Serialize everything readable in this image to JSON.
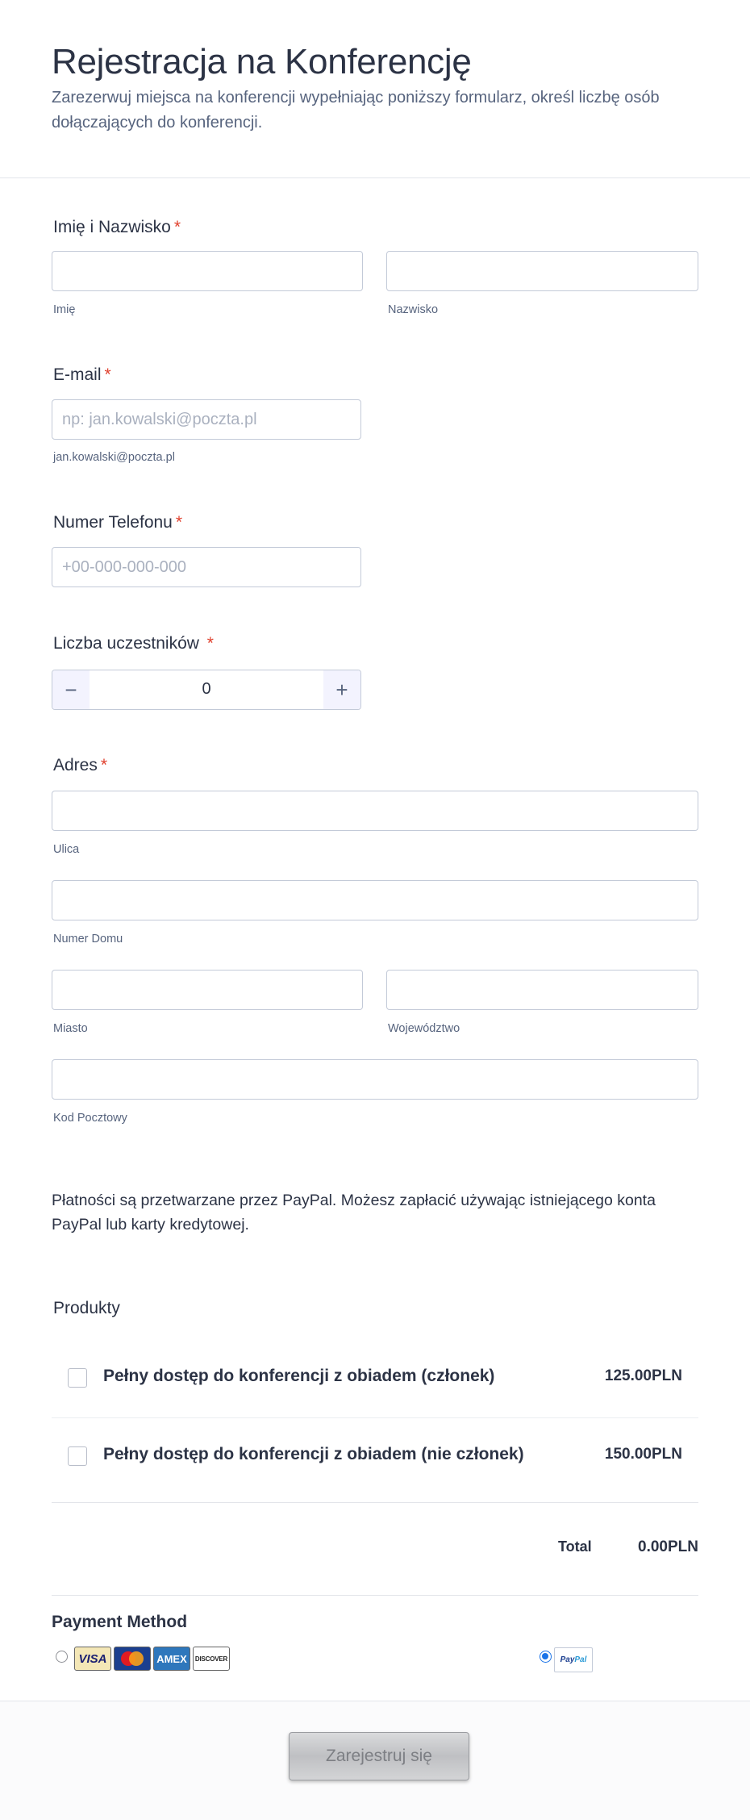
{
  "header": {
    "title": "Rejestracja na Konferencję",
    "subtitle": "Zarezerwuj miejsca na konferencji wypełniając poniższy formularz, określ liczbę osób dołączających do konferencji."
  },
  "name_field": {
    "label": "Imię i Nazwisko",
    "required_mark": "*",
    "first_value": "",
    "last_value": "",
    "first_sublabel": "Imię",
    "last_sublabel": "Nazwisko"
  },
  "email_field": {
    "label": "E-mail",
    "required_mark": "*",
    "value": "",
    "placeholder": "np: jan.kowalski@poczta.pl",
    "sublabel": "jan.kowalski@poczta.pl"
  },
  "phone_field": {
    "label": "Numer Telefonu",
    "required_mark": "*",
    "value": "",
    "placeholder": "+00-000-000-000"
  },
  "participants_field": {
    "label": "Liczba uczestników",
    "required_mark": "*",
    "minus": "−",
    "plus": "+",
    "value": "0"
  },
  "address_field": {
    "label": "Adres",
    "required_mark": "*",
    "street_sublabel": "Ulica",
    "house_sublabel": "Numer Domu",
    "city_sublabel": "Miasto",
    "state_sublabel": "Województwo",
    "postal_sublabel": "Kod Pocztowy"
  },
  "payment_info": "Płatności są przetwarzane przez PayPal. Możesz zapłacić używając istniejącego konta PayPal lub karty kredytowej.",
  "products": {
    "label": "Produkty",
    "items": [
      {
        "name": "Pełny dostęp do konferencji z obiadem (członek)",
        "price": "125.00",
        "currency": "PLN",
        "checked": false
      },
      {
        "name": "Pełny dostęp do konferencji z obiadem (nie członek)",
        "price": "150.00",
        "currency": "PLN",
        "checked": false
      }
    ],
    "total_label": "Total",
    "total_value": "0.00",
    "total_currency": "PLN"
  },
  "payment_method": {
    "label": "Payment Method",
    "options": [
      {
        "name": "cards",
        "selected": false,
        "cards": [
          "VISA",
          "MasterCard",
          "AMEX",
          "DISCOVER"
        ]
      },
      {
        "name": "paypal",
        "selected": true,
        "logo_text_a": "Pay",
        "logo_text_b": "Pal"
      }
    ]
  },
  "submit_label": "Zarejestruj się",
  "colors": {
    "text": "#2c3345",
    "muted": "#57647e",
    "required": "#e0412e",
    "border": "#c3cad8",
    "radio_selected": "#1a73e8"
  }
}
